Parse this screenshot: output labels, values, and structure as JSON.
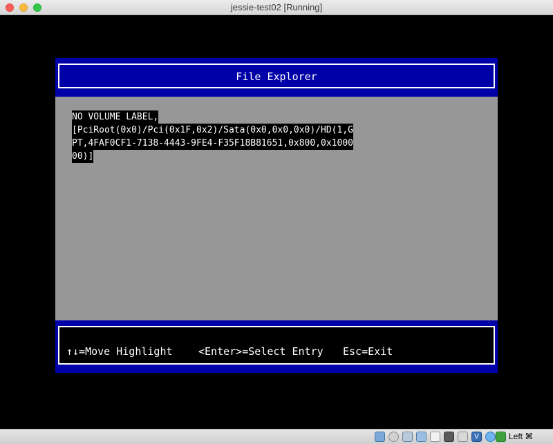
{
  "window": {
    "title": "jessie-test02 [Running]"
  },
  "file_explorer": {
    "title": "File Explorer",
    "entry_lines": [
      "NO VOLUME LABEL,",
      "[PciRoot(0x0)/Pci(0x1F,0x2)/Sata(0x0,0x0,0x0)/HD(1,G",
      "PT,4FAF0CF1-7138-4443-9FE4-F35F18B81651,0x800,0x1000",
      "00)]"
    ],
    "help": {
      "move": "↑↓=Move Highlight",
      "enter": "<Enter>=Select Entry",
      "esc": "Esc=Exit"
    }
  },
  "statusbar": {
    "vt_label": "V",
    "host_key": "Left ⌘",
    "icons": [
      "hard-disk-icon",
      "optical-drive-icon",
      "usb-icon",
      "network-icon",
      "shared-folders-icon",
      "video-capture-icon",
      "remote-display-icon",
      "virtualization-icon",
      "mouse-integration-icon",
      "keyboard-capture-icon"
    ]
  }
}
